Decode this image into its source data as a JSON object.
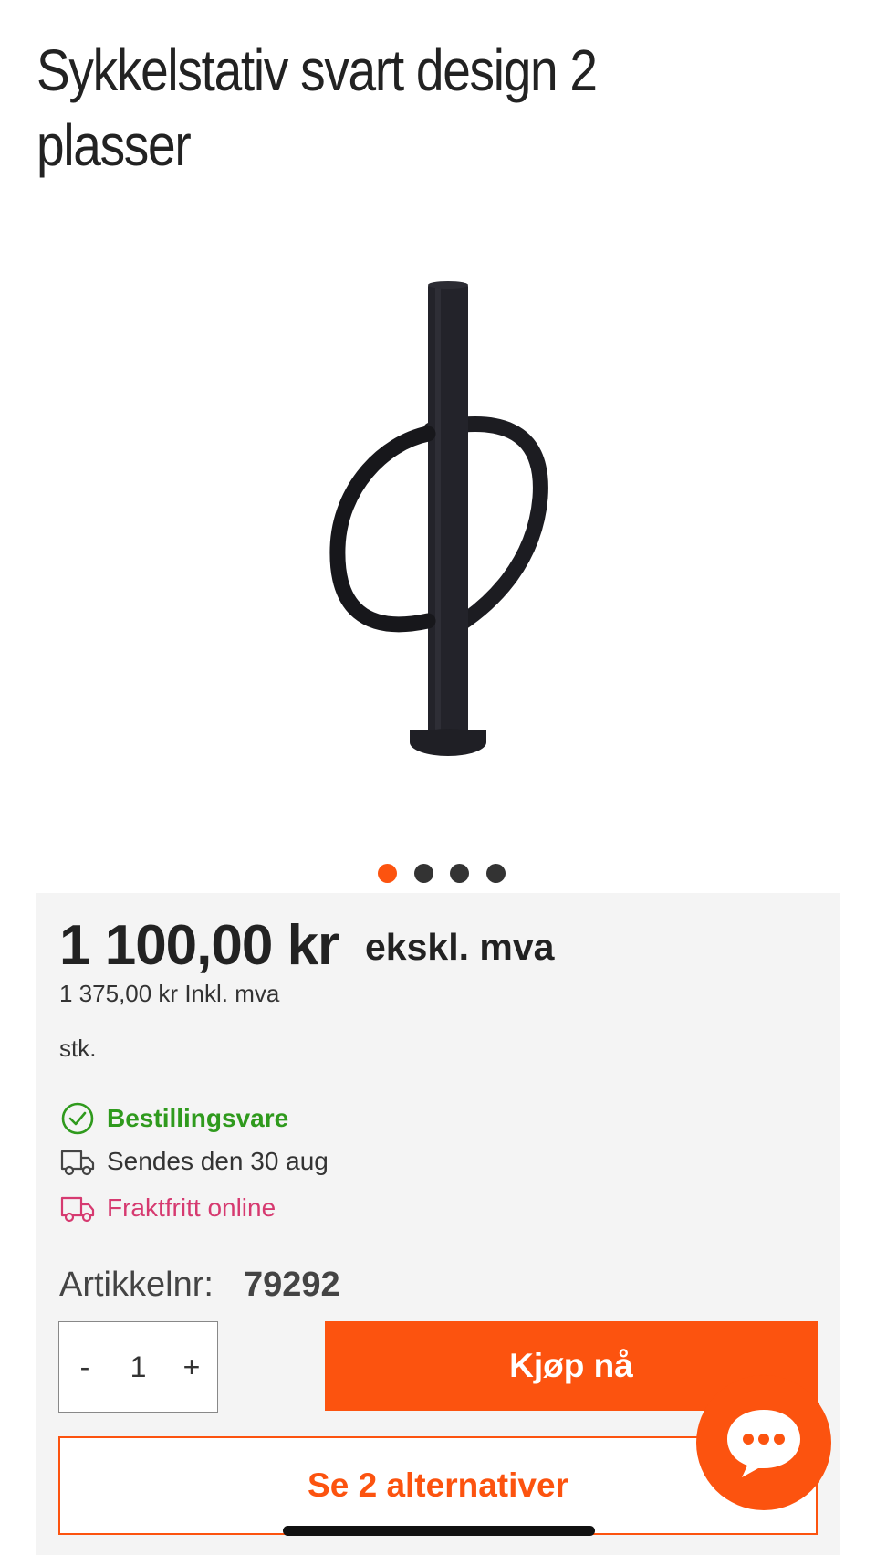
{
  "product": {
    "title": "Sykkelstativ svart design 2 plasser",
    "image_icon": "bike-rack-image"
  },
  "carousel": {
    "total": 4,
    "active_index": 0,
    "active_color": "#fc530f",
    "inactive_color": "#333333"
  },
  "price": {
    "main": "1 100,00 kr",
    "suffix": "ekskl. mva",
    "incl": "1 375,00 kr Inkl. mva",
    "unit": "stk."
  },
  "status": {
    "availability": "Bestillingsvare",
    "availability_icon": "check-circle-icon",
    "shipping": "Sendes den 30 aug",
    "shipping_icon": "truck-icon",
    "freight": "Fraktfritt online",
    "freight_icon": "truck-icon",
    "availability_color": "#2f9a1d",
    "freight_color": "#d63a70"
  },
  "article": {
    "label": "Artikkelnr:",
    "number": "79292"
  },
  "quantity": {
    "minus": "-",
    "value": "1",
    "plus": "+"
  },
  "actions": {
    "buy_label": "Kjøp nå",
    "alternatives_label": "Se 2 alternativer",
    "accent_color": "#fc530f",
    "chat_icon": "chat-bubble-icon"
  }
}
